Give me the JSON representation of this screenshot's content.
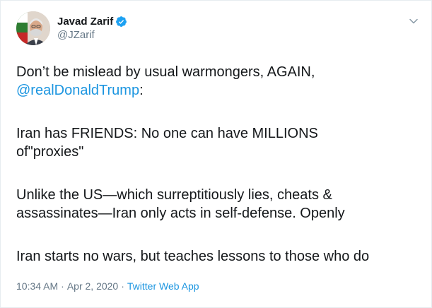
{
  "author": {
    "name": "Javad Zarif",
    "handle": "@JZarif",
    "verified": true,
    "avatar_icon": "profile-photo"
  },
  "tweet": {
    "line1": "Don’t be mislead by usual warmongers, AGAIN,",
    "mention": "@realDonaldTrump",
    "mention_suffix": ":",
    "para2_line1": "Iran has FRIENDS: No one can have MILLIONS",
    "para2_line2": "of\"proxies\"",
    "para3_line1": "Unlike the US—which surreptitiously lies, cheats &",
    "para3_line2": "assassinates—Iran only acts in self-defense. Openly",
    "para4": "Iran starts no wars, but teaches lessons to those who do"
  },
  "meta": {
    "time": "10:34 AM",
    "separator": "·",
    "date": "Apr 2, 2020",
    "source": "Twitter Web App"
  },
  "colors": {
    "link": "#1b95e0",
    "secondary_text": "#657786",
    "verified": "#1da1f2"
  }
}
